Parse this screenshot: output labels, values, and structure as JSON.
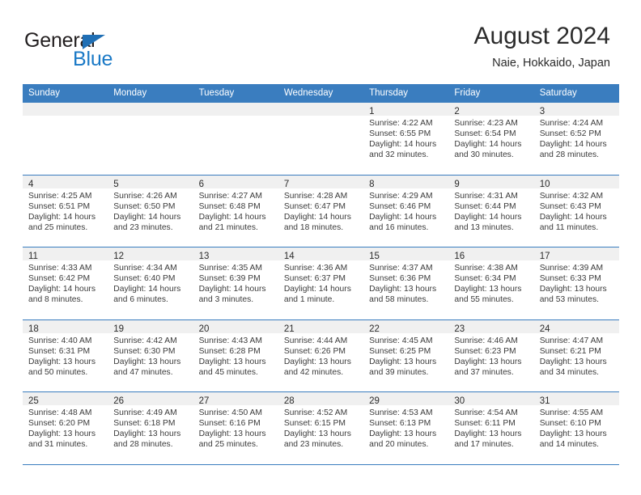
{
  "brand": {
    "name_top": "General",
    "name_bottom": "Blue",
    "triangle_color": "#1f6fb5",
    "text_color": "#231f20",
    "blue_color": "#1a79c6"
  },
  "header": {
    "title": "August 2024",
    "subtitle": "Naie, Hokkaido, Japan"
  },
  "theme": {
    "header_band": "#3a7dbf",
    "daynum_band": "#f0f0f0",
    "grid_line": "#3a7dbf",
    "text": "#3b3b3b"
  },
  "weekdays": [
    "Sunday",
    "Monday",
    "Tuesday",
    "Wednesday",
    "Thursday",
    "Friday",
    "Saturday"
  ],
  "labels": {
    "sunrise": "Sunrise:",
    "sunset": "Sunset:",
    "daylight": "Daylight:"
  },
  "weeks": [
    [
      {
        "day": "",
        "sunrise": "",
        "sunset": "",
        "daylight_1": "",
        "daylight_2": ""
      },
      {
        "day": "",
        "sunrise": "",
        "sunset": "",
        "daylight_1": "",
        "daylight_2": ""
      },
      {
        "day": "",
        "sunrise": "",
        "sunset": "",
        "daylight_1": "",
        "daylight_2": ""
      },
      {
        "day": "",
        "sunrise": "",
        "sunset": "",
        "daylight_1": "",
        "daylight_2": ""
      },
      {
        "day": "1",
        "sunrise": "Sunrise: 4:22 AM",
        "sunset": "Sunset: 6:55 PM",
        "daylight_1": "Daylight: 14 hours",
        "daylight_2": "and 32 minutes."
      },
      {
        "day": "2",
        "sunrise": "Sunrise: 4:23 AM",
        "sunset": "Sunset: 6:54 PM",
        "daylight_1": "Daylight: 14 hours",
        "daylight_2": "and 30 minutes."
      },
      {
        "day": "3",
        "sunrise": "Sunrise: 4:24 AM",
        "sunset": "Sunset: 6:52 PM",
        "daylight_1": "Daylight: 14 hours",
        "daylight_2": "and 28 minutes."
      }
    ],
    [
      {
        "day": "4",
        "sunrise": "Sunrise: 4:25 AM",
        "sunset": "Sunset: 6:51 PM",
        "daylight_1": "Daylight: 14 hours",
        "daylight_2": "and 25 minutes."
      },
      {
        "day": "5",
        "sunrise": "Sunrise: 4:26 AM",
        "sunset": "Sunset: 6:50 PM",
        "daylight_1": "Daylight: 14 hours",
        "daylight_2": "and 23 minutes."
      },
      {
        "day": "6",
        "sunrise": "Sunrise: 4:27 AM",
        "sunset": "Sunset: 6:48 PM",
        "daylight_1": "Daylight: 14 hours",
        "daylight_2": "and 21 minutes."
      },
      {
        "day": "7",
        "sunrise": "Sunrise: 4:28 AM",
        "sunset": "Sunset: 6:47 PM",
        "daylight_1": "Daylight: 14 hours",
        "daylight_2": "and 18 minutes."
      },
      {
        "day": "8",
        "sunrise": "Sunrise: 4:29 AM",
        "sunset": "Sunset: 6:46 PM",
        "daylight_1": "Daylight: 14 hours",
        "daylight_2": "and 16 minutes."
      },
      {
        "day": "9",
        "sunrise": "Sunrise: 4:31 AM",
        "sunset": "Sunset: 6:44 PM",
        "daylight_1": "Daylight: 14 hours",
        "daylight_2": "and 13 minutes."
      },
      {
        "day": "10",
        "sunrise": "Sunrise: 4:32 AM",
        "sunset": "Sunset: 6:43 PM",
        "daylight_1": "Daylight: 14 hours",
        "daylight_2": "and 11 minutes."
      }
    ],
    [
      {
        "day": "11",
        "sunrise": "Sunrise: 4:33 AM",
        "sunset": "Sunset: 6:42 PM",
        "daylight_1": "Daylight: 14 hours",
        "daylight_2": "and 8 minutes."
      },
      {
        "day": "12",
        "sunrise": "Sunrise: 4:34 AM",
        "sunset": "Sunset: 6:40 PM",
        "daylight_1": "Daylight: 14 hours",
        "daylight_2": "and 6 minutes."
      },
      {
        "day": "13",
        "sunrise": "Sunrise: 4:35 AM",
        "sunset": "Sunset: 6:39 PM",
        "daylight_1": "Daylight: 14 hours",
        "daylight_2": "and 3 minutes."
      },
      {
        "day": "14",
        "sunrise": "Sunrise: 4:36 AM",
        "sunset": "Sunset: 6:37 PM",
        "daylight_1": "Daylight: 14 hours",
        "daylight_2": "and 1 minute."
      },
      {
        "day": "15",
        "sunrise": "Sunrise: 4:37 AM",
        "sunset": "Sunset: 6:36 PM",
        "daylight_1": "Daylight: 13 hours",
        "daylight_2": "and 58 minutes."
      },
      {
        "day": "16",
        "sunrise": "Sunrise: 4:38 AM",
        "sunset": "Sunset: 6:34 PM",
        "daylight_1": "Daylight: 13 hours",
        "daylight_2": "and 55 minutes."
      },
      {
        "day": "17",
        "sunrise": "Sunrise: 4:39 AM",
        "sunset": "Sunset: 6:33 PM",
        "daylight_1": "Daylight: 13 hours",
        "daylight_2": "and 53 minutes."
      }
    ],
    [
      {
        "day": "18",
        "sunrise": "Sunrise: 4:40 AM",
        "sunset": "Sunset: 6:31 PM",
        "daylight_1": "Daylight: 13 hours",
        "daylight_2": "and 50 minutes."
      },
      {
        "day": "19",
        "sunrise": "Sunrise: 4:42 AM",
        "sunset": "Sunset: 6:30 PM",
        "daylight_1": "Daylight: 13 hours",
        "daylight_2": "and 47 minutes."
      },
      {
        "day": "20",
        "sunrise": "Sunrise: 4:43 AM",
        "sunset": "Sunset: 6:28 PM",
        "daylight_1": "Daylight: 13 hours",
        "daylight_2": "and 45 minutes."
      },
      {
        "day": "21",
        "sunrise": "Sunrise: 4:44 AM",
        "sunset": "Sunset: 6:26 PM",
        "daylight_1": "Daylight: 13 hours",
        "daylight_2": "and 42 minutes."
      },
      {
        "day": "22",
        "sunrise": "Sunrise: 4:45 AM",
        "sunset": "Sunset: 6:25 PM",
        "daylight_1": "Daylight: 13 hours",
        "daylight_2": "and 39 minutes."
      },
      {
        "day": "23",
        "sunrise": "Sunrise: 4:46 AM",
        "sunset": "Sunset: 6:23 PM",
        "daylight_1": "Daylight: 13 hours",
        "daylight_2": "and 37 minutes."
      },
      {
        "day": "24",
        "sunrise": "Sunrise: 4:47 AM",
        "sunset": "Sunset: 6:21 PM",
        "daylight_1": "Daylight: 13 hours",
        "daylight_2": "and 34 minutes."
      }
    ],
    [
      {
        "day": "25",
        "sunrise": "Sunrise: 4:48 AM",
        "sunset": "Sunset: 6:20 PM",
        "daylight_1": "Daylight: 13 hours",
        "daylight_2": "and 31 minutes."
      },
      {
        "day": "26",
        "sunrise": "Sunrise: 4:49 AM",
        "sunset": "Sunset: 6:18 PM",
        "daylight_1": "Daylight: 13 hours",
        "daylight_2": "and 28 minutes."
      },
      {
        "day": "27",
        "sunrise": "Sunrise: 4:50 AM",
        "sunset": "Sunset: 6:16 PM",
        "daylight_1": "Daylight: 13 hours",
        "daylight_2": "and 25 minutes."
      },
      {
        "day": "28",
        "sunrise": "Sunrise: 4:52 AM",
        "sunset": "Sunset: 6:15 PM",
        "daylight_1": "Daylight: 13 hours",
        "daylight_2": "and 23 minutes."
      },
      {
        "day": "29",
        "sunrise": "Sunrise: 4:53 AM",
        "sunset": "Sunset: 6:13 PM",
        "daylight_1": "Daylight: 13 hours",
        "daylight_2": "and 20 minutes."
      },
      {
        "day": "30",
        "sunrise": "Sunrise: 4:54 AM",
        "sunset": "Sunset: 6:11 PM",
        "daylight_1": "Daylight: 13 hours",
        "daylight_2": "and 17 minutes."
      },
      {
        "day": "31",
        "sunrise": "Sunrise: 4:55 AM",
        "sunset": "Sunset: 6:10 PM",
        "daylight_1": "Daylight: 13 hours",
        "daylight_2": "and 14 minutes."
      }
    ]
  ]
}
